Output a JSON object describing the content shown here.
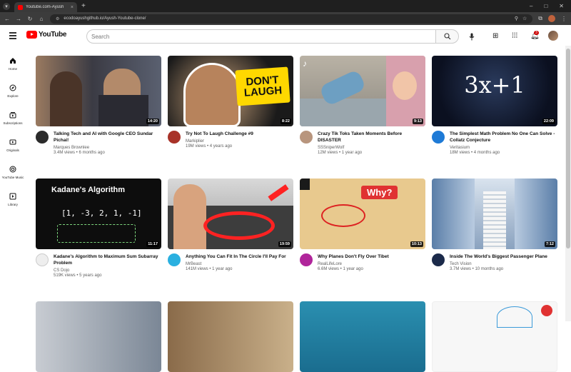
{
  "browser": {
    "tab_title": "Youtube.com-Ayush",
    "url": "ecodoayushgithub.io/Ayush-Youtube-clone/"
  },
  "header": {
    "logo_text": "YouTube",
    "search_placeholder": "Search",
    "notification_count": "3"
  },
  "sidebar": {
    "items": [
      {
        "label": "Home",
        "icon": "home-icon"
      },
      {
        "label": "Explore",
        "icon": "compass-icon"
      },
      {
        "label": "Subscriptions",
        "icon": "subscriptions-icon"
      },
      {
        "label": "Originals",
        "icon": "originals-icon"
      },
      {
        "label": "YouTube Music",
        "icon": "music-icon"
      },
      {
        "label": "Library",
        "icon": "library-icon"
      }
    ]
  },
  "videos": [
    {
      "title": "Talking Tech and AI with Google CEO Sundar Pichai!",
      "channel": "Marques Brownlee",
      "stats": "3.4M views • 6 months ago",
      "duration": "14:20"
    },
    {
      "title": "Try Not To Laugh Challenge #9",
      "channel": "Markiplier",
      "stats": "19M views • 4 years ago",
      "duration": "8:22",
      "thumb_text": "DON'T LAUGH"
    },
    {
      "title": "Crazy Tik Toks Taken Moments Before DISASTER",
      "channel": "SSSniperWolf",
      "stats": "12M views • 1 year ago",
      "duration": "9:13"
    },
    {
      "title": "The Simplest Math Problem No One Can Solve - Collatz Conjecture",
      "channel": "Veritasium",
      "stats": "18M views • 4 months ago",
      "duration": "22:09",
      "thumb_text": "3x+1"
    },
    {
      "title": "Kadane's Algorithm to Maximum Sum Subarray Problem",
      "channel": "CS Dojo",
      "stats": "519K views • 5 years ago",
      "duration": "11:17",
      "thumb_text": "Kadane's Algorithm"
    },
    {
      "title": "Anything You Can Fit In The Circle I'll Pay For",
      "channel": "MrBeast",
      "stats": "141M views • 1 year ago",
      "duration": "19:59"
    },
    {
      "title": "Why Planes Don't Fly Over Tibet",
      "channel": "RealLifeLore",
      "stats": "6.6M views • 1 year ago",
      "duration": "10:13",
      "thumb_text": "Why?"
    },
    {
      "title": "Inside The World's Biggest Passenger Plane",
      "channel": "Tech Vision",
      "stats": "3.7M views • 10 months ago",
      "duration": "7:12"
    }
  ],
  "colors": {
    "accent": "#ff0000"
  }
}
